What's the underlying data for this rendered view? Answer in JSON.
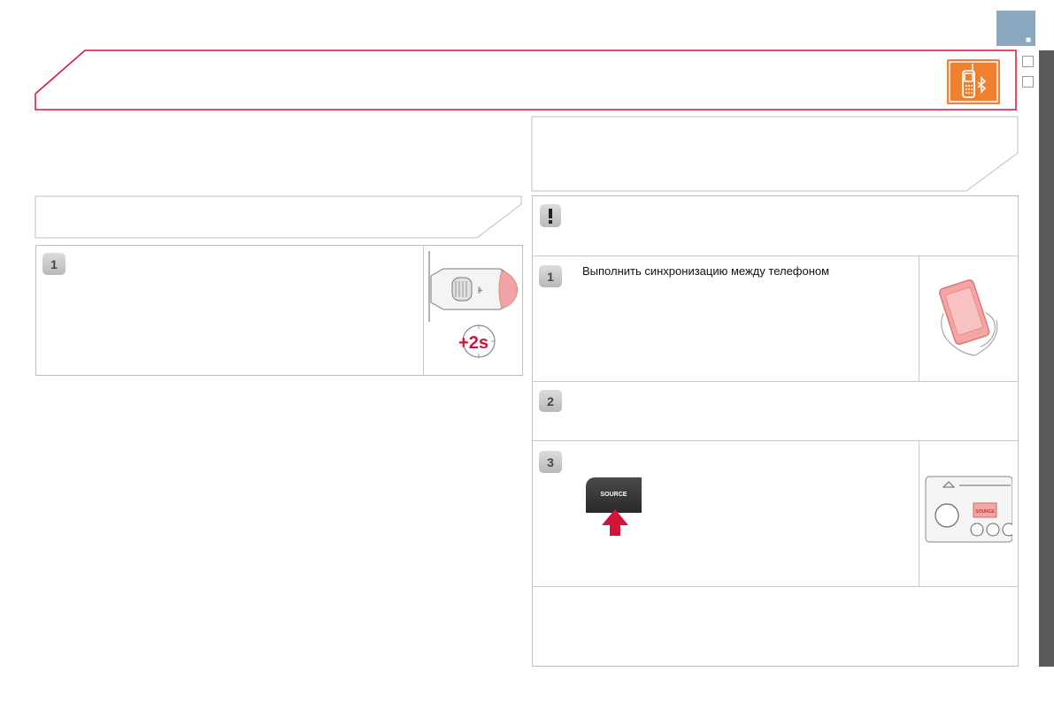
{
  "page": {
    "right_tab_marker": "■",
    "colors": {
      "accent_red": "#d3143a",
      "tab_blue": "#8aa8c0",
      "side_bar": "#5a5a5a",
      "icon_orange": "#f07f2e"
    }
  },
  "header": {
    "icon": "bluetooth-phone-icon"
  },
  "left_column": {
    "step1": {
      "number": "1",
      "icons": [
        "steering-stalk-icon",
        "timer-2s-icon"
      ],
      "timer_label": "+2s"
    }
  },
  "right_column": {
    "warning": {
      "icon": "exclamation-icon"
    },
    "step1": {
      "number": "1",
      "text": "Выполнить синхронизацию между телефоном",
      "icon": "hand-phone-icon"
    },
    "step2": {
      "number": "2"
    },
    "step3": {
      "number": "3",
      "button_label": "SOURCE",
      "icon": "radio-panel-icon",
      "panel_button_label": "SOURCE"
    }
  }
}
